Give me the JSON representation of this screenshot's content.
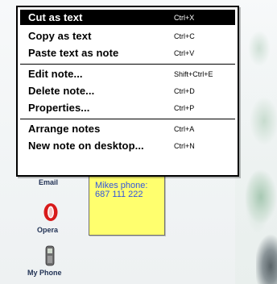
{
  "context_menu": {
    "items": [
      {
        "label": "Cut as text",
        "shortcut": "Ctrl+X"
      },
      {
        "label": "Copy as text",
        "shortcut": "Ctrl+C"
      },
      {
        "label": "Paste text as note",
        "shortcut": "Ctrl+V"
      },
      {
        "label": "Edit note...",
        "shortcut": "Shift+Ctrl+E"
      },
      {
        "label": "Delete note...",
        "shortcut": "Ctrl+D"
      },
      {
        "label": "Properties...",
        "shortcut": "Ctrl+P"
      },
      {
        "label": "Arrange notes",
        "shortcut": "Ctrl+A"
      },
      {
        "label": "New note on desktop...",
        "shortcut": "Ctrl+N"
      }
    ],
    "selected_index": 0
  },
  "desktop": {
    "icons": [
      {
        "label": "Email",
        "icon": "envelope-icon"
      },
      {
        "label": "Opera",
        "icon": "opera-icon"
      },
      {
        "label": "My Phone",
        "icon": "phone-icon"
      }
    ]
  },
  "note": {
    "lines": [
      "Mikes phone:",
      "687 111 222"
    ],
    "color": "#ffff6e",
    "text_color": "#3355dd"
  }
}
